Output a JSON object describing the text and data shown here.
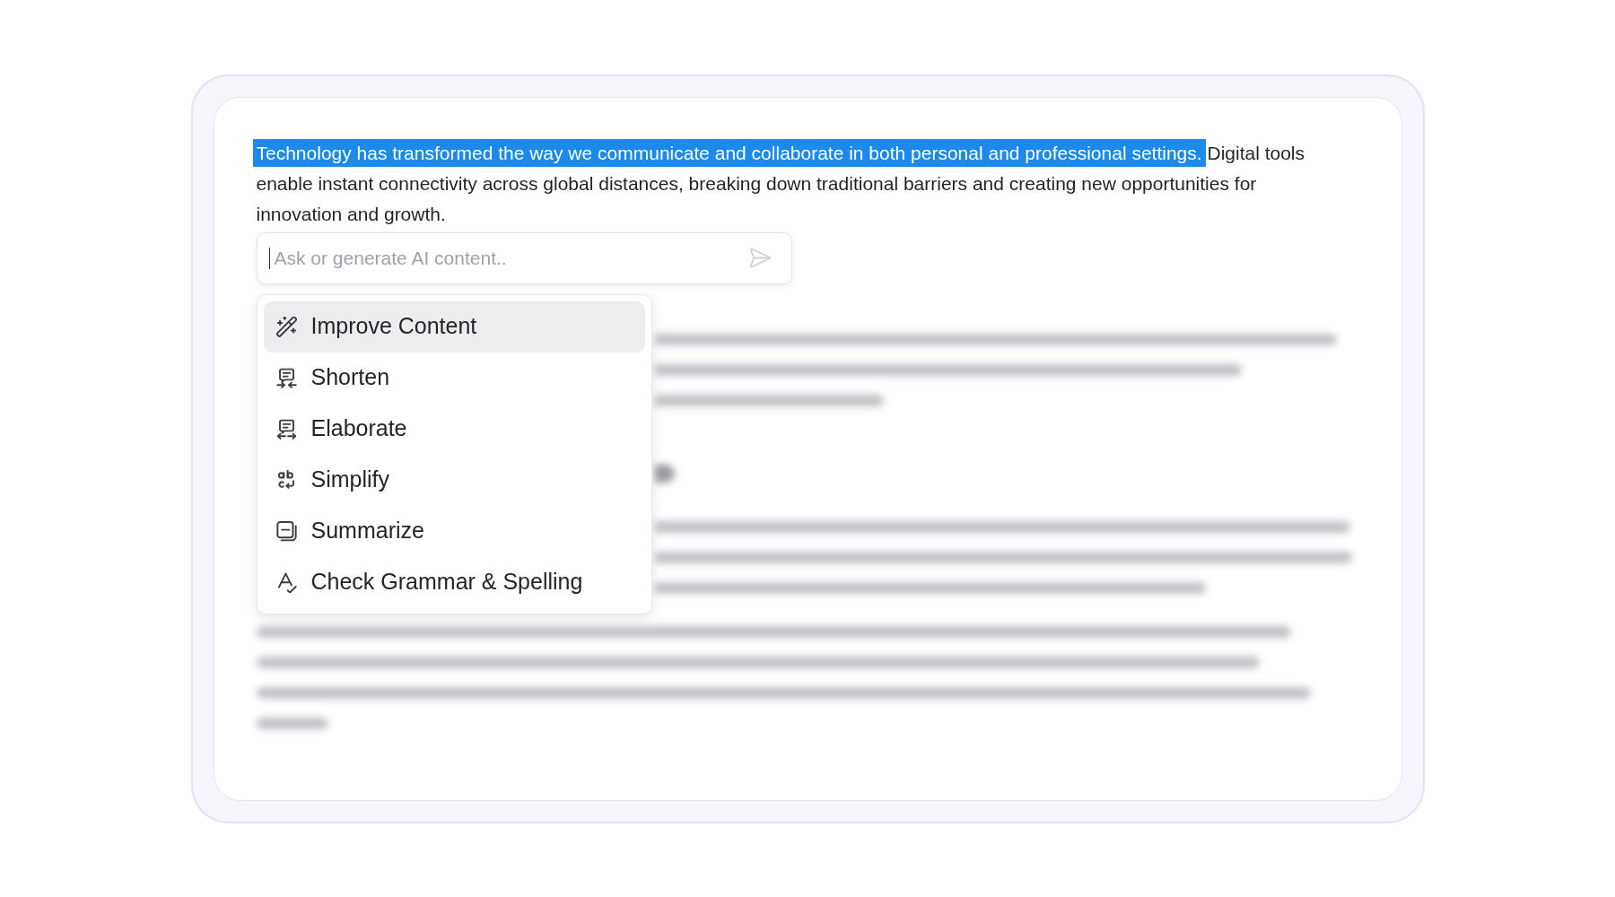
{
  "editor": {
    "paragraph": {
      "segments": [
        {
          "text": "Technology has transformed the way we communicate and collaborate in both personal and professional settings.",
          "selected": true
        },
        {
          "text": "Digital tools enable instant connectivity across global distances, breaking down traditional barriers and creating new opportunities for innovation and growth.",
          "selected": false
        }
      ]
    },
    "ai_prompt": {
      "placeholder": "Ask or generate AI content..",
      "focused": true
    },
    "ai_menu": {
      "items": [
        {
          "label": "Improve Content",
          "selected": true
        },
        {
          "label": "Shorten",
          "selected": false
        },
        {
          "label": "Elaborate",
          "selected": false
        },
        {
          "label": "Simplify",
          "selected": false
        },
        {
          "label": "Summarize",
          "selected": false
        },
        {
          "label": "Check Grammar & Spelling",
          "selected": false
        }
      ]
    }
  }
}
